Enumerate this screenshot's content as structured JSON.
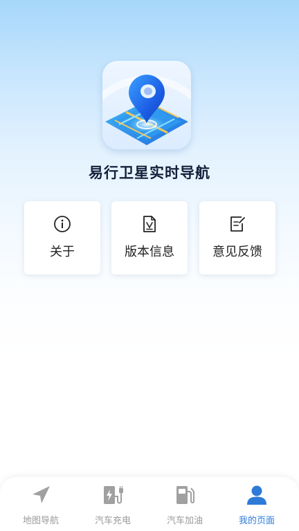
{
  "app": {
    "name": "易行卫星实时导航",
    "logo_icon": "map-pin-on-satellite-map-icon"
  },
  "menu": {
    "items": [
      {
        "label": "关于",
        "icon": "info-circle-icon"
      },
      {
        "label": "版本信息",
        "icon": "version-document-icon"
      },
      {
        "label": "意见反馈",
        "icon": "feedback-edit-icon"
      }
    ]
  },
  "tabbar": {
    "active_index": 3,
    "active_color": "#2e7ad7",
    "inactive_color": "#9a9a9a",
    "items": [
      {
        "label": "地图导航",
        "icon": "navigation-arrow-icon"
      },
      {
        "label": "汽车充电",
        "icon": "ev-charger-icon"
      },
      {
        "label": "汽车加油",
        "icon": "fuel-pump-icon"
      },
      {
        "label": "我的页面",
        "icon": "user-profile-icon"
      }
    ]
  }
}
